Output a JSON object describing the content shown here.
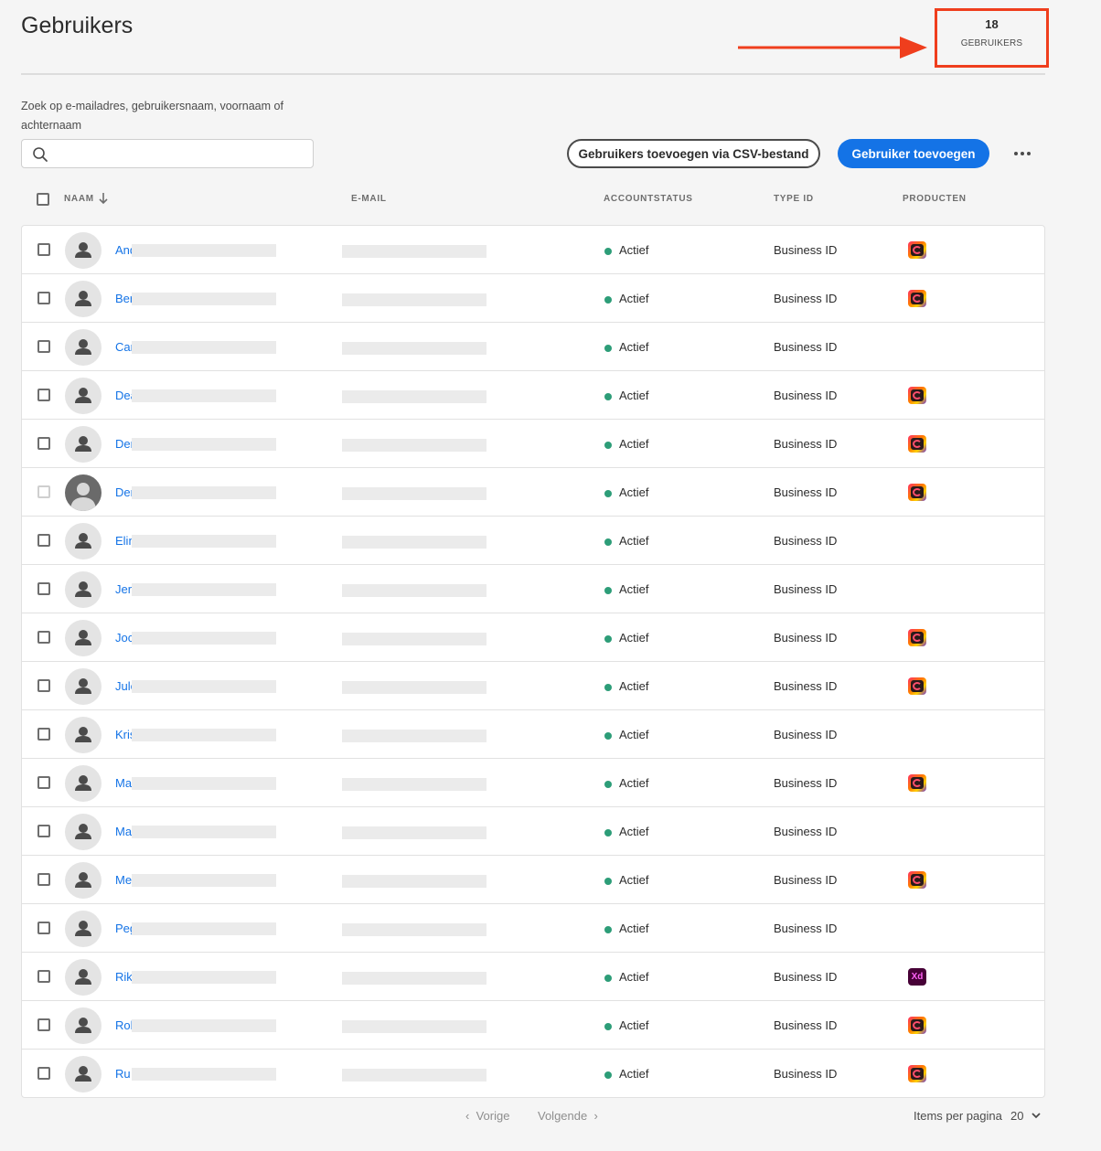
{
  "page": {
    "title": "Gebruikers",
    "count_value": "18",
    "count_label": "GEBRUIKERS"
  },
  "search": {
    "label": "Zoek op e-mailadres, gebruikersnaam, voornaam of achternaam",
    "placeholder": "",
    "value": ""
  },
  "toolbar": {
    "csv_button": "Gebruikers toevoegen via CSV-bestand",
    "add_button": "Gebruiker toevoegen"
  },
  "table": {
    "headers": {
      "name": "NAAM",
      "email": "E-MAIL",
      "status": "ACCOUNTSTATUS",
      "type": "TYPE ID",
      "products": "PRODUCTEN"
    },
    "rows": [
      {
        "name": "And",
        "status": "Actief",
        "type": "Business ID",
        "product": "cc-icon"
      },
      {
        "name": "Ber",
        "status": "Actief",
        "type": "Business ID",
        "product": "cc-icon"
      },
      {
        "name": "Car",
        "status": "Actief",
        "type": "Business ID",
        "product": ""
      },
      {
        "name": "Dea",
        "status": "Actief",
        "type": "Business ID",
        "product": "cc-icon"
      },
      {
        "name": "Der",
        "status": "Actief",
        "type": "Business ID",
        "product": "cc-icon"
      },
      {
        "name": "Der",
        "status": "Actief",
        "type": "Business ID",
        "product": "cc-icon",
        "photo": true,
        "disabled": true
      },
      {
        "name": "Elin",
        "status": "Actief",
        "type": "Business ID",
        "product": ""
      },
      {
        "name": "Jero",
        "status": "Actief",
        "type": "Business ID",
        "product": ""
      },
      {
        "name": "Joc",
        "status": "Actief",
        "type": "Business ID",
        "product": "cc-icon"
      },
      {
        "name": "Jule",
        "status": "Actief",
        "type": "Business ID",
        "product": "cc-icon"
      },
      {
        "name": "Kris",
        "status": "Actief",
        "type": "Business ID",
        "product": ""
      },
      {
        "name": "Ma",
        "status": "Actief",
        "type": "Business ID",
        "product": "cc-icon"
      },
      {
        "name": "Ma",
        "status": "Actief",
        "type": "Business ID",
        "product": ""
      },
      {
        "name": "Me",
        "status": "Actief",
        "type": "Business ID",
        "product": "cc-icon"
      },
      {
        "name": "Peg",
        "status": "Actief",
        "type": "Business ID",
        "product": ""
      },
      {
        "name": "Rik",
        "status": "Actief",
        "type": "Business ID",
        "product": "xd-icon",
        "product_text": "Xd"
      },
      {
        "name": "Rol",
        "status": "Actief",
        "type": "Business ID",
        "product": "cc-icon"
      },
      {
        "name": "Ru",
        "status": "Actief",
        "type": "Business ID",
        "product": "cc-icon"
      }
    ]
  },
  "pagination": {
    "prev": "Vorige",
    "next": "Volgende",
    "per_page_label": "Items per pagina",
    "per_page_value": "20"
  },
  "colors": {
    "accent": "#1473e6",
    "status_active": "#2d9d78",
    "highlight": "#ef3e1d"
  },
  "icons": [
    "search-icon",
    "sort-down-icon",
    "more-icon",
    "user-icon",
    "cc-icon",
    "xd-icon",
    "chevron-left-icon",
    "chevron-right-icon",
    "chevron-down-icon",
    "arrow-icon"
  ]
}
